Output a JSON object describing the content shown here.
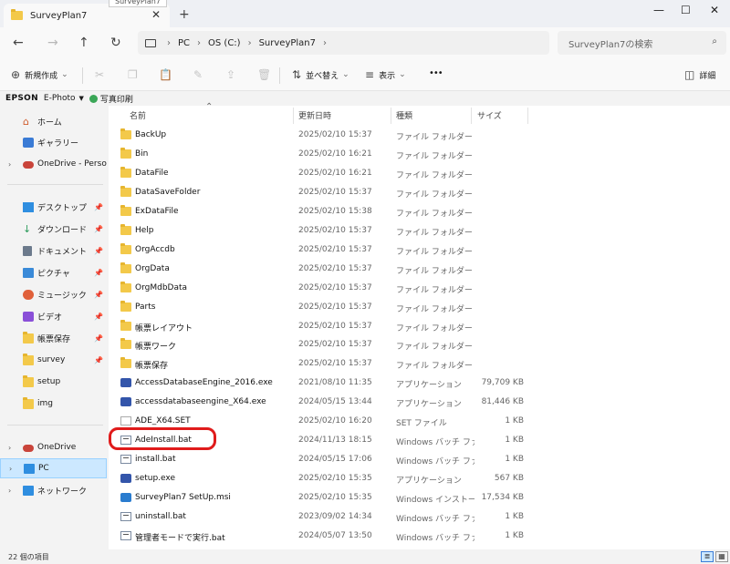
{
  "window": {
    "tab_title": "SurveyPlan7",
    "tooltip": "SurveyPlan7",
    "close_tab": "✕",
    "new_tab": "+",
    "minimize": "—",
    "maximize": "☐",
    "close": "✕"
  },
  "nav": {
    "back": "←",
    "forward": "→",
    "up": "↑",
    "refresh": "↻",
    "breadcrumb": [
      "PC",
      "OS (C:)",
      "SurveyPlan7"
    ],
    "breadcrumb_sep": "›",
    "search_placeholder": "SurveyPlan7の検索"
  },
  "toolbar": {
    "new_label": "新規作成",
    "sort_label": "並べ替え",
    "view_label": "表示",
    "more": "•••",
    "details_label": "詳細",
    "cut": "✂",
    "copy": "❐",
    "paste": "📋",
    "rename": "✎",
    "share": "⇪",
    "delete": "🗑"
  },
  "epson": {
    "brand": "EPSON",
    "app": "E-Photo",
    "print_label": "写真印刷"
  },
  "sidebar": {
    "items": [
      {
        "label": "ホーム",
        "icon": "home-icon"
      },
      {
        "label": "ギャラリー",
        "icon": "gallery-icon"
      },
      {
        "label": "OneDrive - Persona",
        "icon": "onedrive-icon"
      },
      {
        "label": "デスクトップ",
        "icon": "desktop-icon"
      },
      {
        "label": "ダウンロード",
        "icon": "download-icon"
      },
      {
        "label": "ドキュメント",
        "icon": "documents-icon"
      },
      {
        "label": "ピクチャ",
        "icon": "pictures-icon"
      },
      {
        "label": "ミュージック",
        "icon": "music-icon"
      },
      {
        "label": "ビデオ",
        "icon": "video-icon"
      },
      {
        "label": "帳票保存",
        "icon": "folder-icon"
      },
      {
        "label": "survey",
        "icon": "folder-icon"
      },
      {
        "label": "setup",
        "icon": "folder-icon"
      },
      {
        "label": "img",
        "icon": "folder-icon"
      },
      {
        "label": "OneDrive",
        "icon": "onedrive-icon"
      },
      {
        "label": "PC",
        "icon": "pc-icon"
      },
      {
        "label": "ネットワーク",
        "icon": "network-icon"
      }
    ]
  },
  "columns": {
    "name": "名前",
    "date": "更新日時",
    "type": "種類",
    "size": "サイズ"
  },
  "files": [
    {
      "name": "BackUp",
      "date": "2025/02/10 15:37",
      "type": "ファイル フォルダー",
      "size": "",
      "kind": "folder"
    },
    {
      "name": "Bin",
      "date": "2025/02/10 16:21",
      "type": "ファイル フォルダー",
      "size": "",
      "kind": "folder"
    },
    {
      "name": "DataFile",
      "date": "2025/02/10 16:21",
      "type": "ファイル フォルダー",
      "size": "",
      "kind": "folder"
    },
    {
      "name": "DataSaveFolder",
      "date": "2025/02/10 15:37",
      "type": "ファイル フォルダー",
      "size": "",
      "kind": "folder"
    },
    {
      "name": "ExDataFile",
      "date": "2025/02/10 15:38",
      "type": "ファイル フォルダー",
      "size": "",
      "kind": "folder"
    },
    {
      "name": "Help",
      "date": "2025/02/10 15:37",
      "type": "ファイル フォルダー",
      "size": "",
      "kind": "folder"
    },
    {
      "name": "OrgAccdb",
      "date": "2025/02/10 15:37",
      "type": "ファイル フォルダー",
      "size": "",
      "kind": "folder"
    },
    {
      "name": "OrgData",
      "date": "2025/02/10 15:37",
      "type": "ファイル フォルダー",
      "size": "",
      "kind": "folder"
    },
    {
      "name": "OrgMdbData",
      "date": "2025/02/10 15:37",
      "type": "ファイル フォルダー",
      "size": "",
      "kind": "folder"
    },
    {
      "name": "Parts",
      "date": "2025/02/10 15:37",
      "type": "ファイル フォルダー",
      "size": "",
      "kind": "folder"
    },
    {
      "name": "帳票レイアウト",
      "date": "2025/02/10 15:37",
      "type": "ファイル フォルダー",
      "size": "",
      "kind": "folder"
    },
    {
      "name": "帳票ワーク",
      "date": "2025/02/10 15:37",
      "type": "ファイル フォルダー",
      "size": "",
      "kind": "folder"
    },
    {
      "name": "帳票保存",
      "date": "2025/02/10 15:37",
      "type": "ファイル フォルダー",
      "size": "",
      "kind": "folder"
    },
    {
      "name": "AccessDatabaseEngine_2016.exe",
      "date": "2021/08/10 11:35",
      "type": "アプリケーション",
      "size": "79,709 KB",
      "kind": "app"
    },
    {
      "name": "accessdatabaseengine_X64.exe",
      "date": "2024/05/15 13:44",
      "type": "アプリケーション",
      "size": "81,446 KB",
      "kind": "app"
    },
    {
      "name": "ADE_X64.SET",
      "date": "2025/02/10 16:20",
      "type": "SET ファイル",
      "size": "1 KB",
      "kind": "file"
    },
    {
      "name": "AdeInstall.bat",
      "date": "2024/11/13 18:15",
      "type": "Windows バッチ ファ...",
      "size": "1 KB",
      "kind": "bat"
    },
    {
      "name": "install.bat",
      "date": "2024/05/15 17:06",
      "type": "Windows バッチ ファ...",
      "size": "1 KB",
      "kind": "bat"
    },
    {
      "name": "setup.exe",
      "date": "2025/02/10 15:35",
      "type": "アプリケーション",
      "size": "567 KB",
      "kind": "app"
    },
    {
      "name": "SurveyPlan7 SetUp.msi",
      "date": "2025/02/10 15:35",
      "type": "Windows インストー...",
      "size": "17,534 KB",
      "kind": "msi"
    },
    {
      "name": "uninstall.bat",
      "date": "2023/09/02 14:34",
      "type": "Windows バッチ ファ...",
      "size": "1 KB",
      "kind": "bat"
    },
    {
      "name": "管理者モードで実行.bat",
      "date": "2024/05/07 13:50",
      "type": "Windows バッチ ファ...",
      "size": "1 KB",
      "kind": "bat"
    }
  ],
  "status": {
    "item_count": "22 個の項目"
  },
  "colors": {
    "highlight": "#e01b1b",
    "selection": "#cce8ff",
    "folder": "#f3c94a"
  }
}
